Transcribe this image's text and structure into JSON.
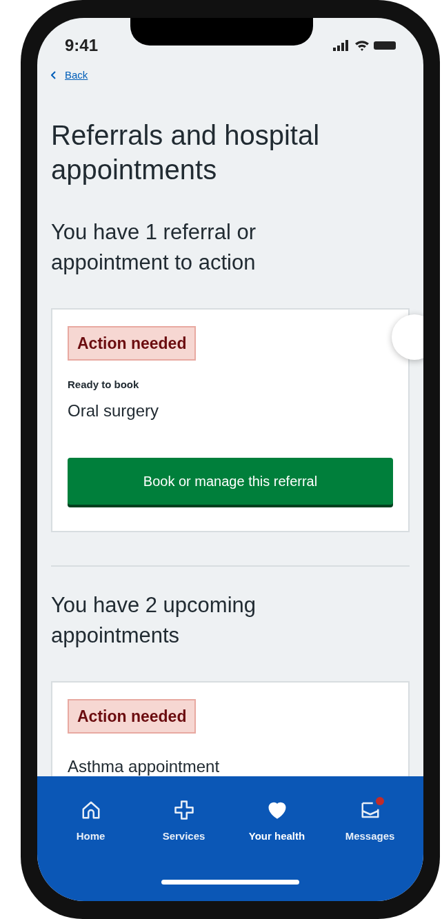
{
  "status_bar": {
    "time": "9:41"
  },
  "back_link": "Back",
  "title": "Referrals and hospital appointments",
  "sections": [
    {
      "heading": "You have 1 referral or appointment to action",
      "cards": [
        {
          "tag": "Action needed",
          "status": "Ready to book",
          "name": "Oral surgery",
          "button": "Book or manage this referral"
        }
      ]
    },
    {
      "heading": "You have 2 upcoming appointments",
      "cards": [
        {
          "tag": "Action needed",
          "name": "Asthma appointment"
        }
      ]
    }
  ],
  "nav": [
    {
      "kind": "home",
      "label": "Home",
      "selected": false,
      "badge": false
    },
    {
      "kind": "services",
      "label": "Services",
      "selected": false,
      "badge": false
    },
    {
      "kind": "health",
      "label": "Your health",
      "selected": true,
      "badge": false
    },
    {
      "kind": "messages",
      "label": "Messages",
      "selected": false,
      "badge": true
    }
  ]
}
